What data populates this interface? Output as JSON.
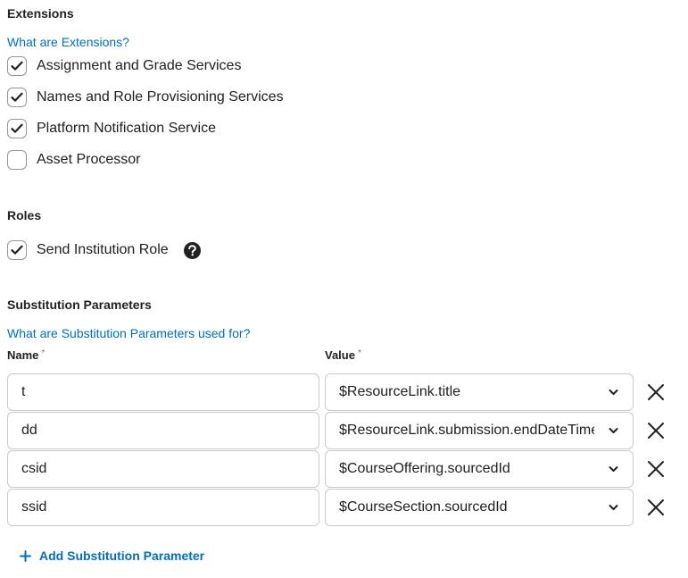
{
  "extensions": {
    "heading": "Extensions",
    "help_link": "What are Extensions?",
    "items": [
      {
        "label": "Assignment and Grade Services",
        "checked": true
      },
      {
        "label": "Names and Role Provisioning Services",
        "checked": true
      },
      {
        "label": "Platform Notification Service",
        "checked": true
      },
      {
        "label": "Asset Processor",
        "checked": false
      }
    ]
  },
  "roles": {
    "heading": "Roles",
    "items": [
      {
        "label": "Send Institution Role",
        "checked": true
      }
    ]
  },
  "substitution": {
    "heading": "Substitution Parameters",
    "help_link": "What are Substitution Parameters used for?",
    "name_label": "Name",
    "value_label": "Value",
    "required_marker": "*",
    "rows": [
      {
        "name": "t",
        "value": "$ResourceLink.title"
      },
      {
        "name": "dd",
        "value": "$ResourceLink.submission.endDateTime"
      },
      {
        "name": "csid",
        "value": "$CourseOffering.sourcedId"
      },
      {
        "name": "ssid",
        "value": "$CourseSection.sourcedId"
      }
    ],
    "add_label": "Add Substitution Parameter"
  },
  "colors": {
    "link": "#006fbf",
    "text": "#202122",
    "border": "#c7cbcd"
  },
  "icons": {
    "check": "check-icon",
    "help": "help-circle-icon",
    "chevron": "chevron-down-icon",
    "remove": "close-icon",
    "add": "plus-icon"
  }
}
